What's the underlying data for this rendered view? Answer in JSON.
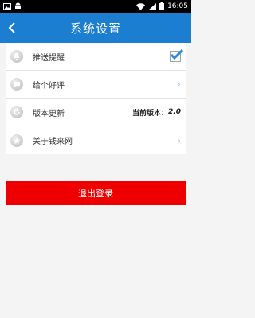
{
  "status_bar": {
    "left_icons": [
      "image-notification-icon",
      "android-icon"
    ],
    "right_icons": [
      "wifi-icon",
      "cell-signal-icon",
      "battery-icon"
    ],
    "time": "16:05"
  },
  "nav": {
    "title": "系统设置",
    "back_icon": "chevron-left-icon",
    "background": "#1b7ed1"
  },
  "settings": {
    "items": [
      {
        "label": "推送提醒",
        "icon": "bell-icon",
        "control": "checkbox",
        "checked": true
      },
      {
        "label": "给个好评",
        "icon": "comment-icon",
        "control": "chevron"
      },
      {
        "label": "版本更新",
        "icon": "refresh-icon",
        "control": "version"
      },
      {
        "label": "关于钱来网",
        "icon": "star-icon",
        "control": "chevron"
      }
    ],
    "version_label": "当前版本：",
    "version_number": "2.0",
    "chevron_glyph": "›"
  },
  "logout": {
    "label": "退出登录",
    "color": "#ee0000"
  }
}
